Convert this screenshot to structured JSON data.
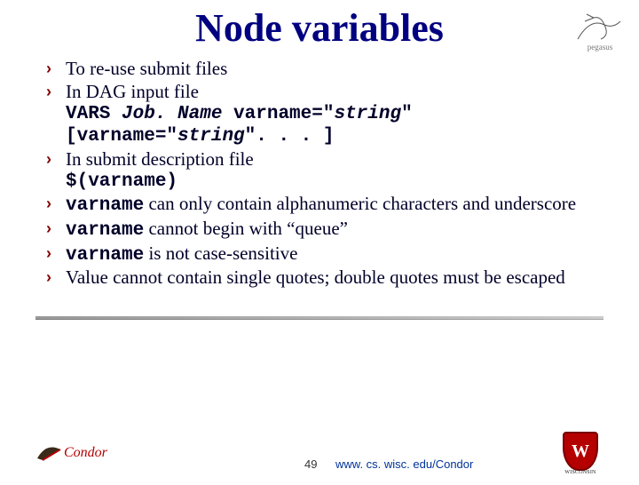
{
  "title": "Node variables",
  "bullets": {
    "b1": "To re-use submit files",
    "b2": "In DAG input file",
    "code1_a": "VARS ",
    "code1_b": "Job. Name",
    "code1_c": " varname=\"",
    "code1_d": "string",
    "code1_e": "\" ",
    "code2_a": "[varname=\"",
    "code2_b": "string",
    "code2_c": "\". . . ]",
    "b3": "In submit description file",
    "code3": "$(varname)",
    "b4_a": "varname",
    "b4_b": " can only contain alphanumeric characters and underscore",
    "b5_a": "varname",
    "b5_b": "  cannot begin with “queue”",
    "b6_a": "varname",
    "b6_b": " is not case-sensitive",
    "b7": "Value cannot contain single quotes; double quotes must be escaped"
  },
  "footer": {
    "page": "49",
    "url": "www. cs. wisc. edu/Condor"
  },
  "icons": {
    "pegasus_label": "pegasus",
    "uw_w": "W",
    "uw_text": "WISCONSIN",
    "condor_text": "Condor"
  }
}
